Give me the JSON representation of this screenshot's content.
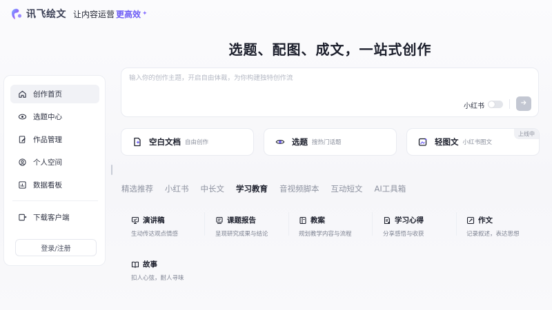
{
  "header": {
    "brand": "讯飞绘文",
    "slogan_prefix": "让内容运营",
    "slogan_highlight": "更高效",
    "logo_icon": "iflytek-logo-icon"
  },
  "sidebar": {
    "items": [
      {
        "label": "创作首页",
        "icon": "home-icon",
        "active": true
      },
      {
        "label": "选题中心",
        "icon": "eye-icon"
      },
      {
        "label": "作品管理",
        "icon": "edit-doc-icon"
      },
      {
        "label": "个人空间",
        "icon": "user-space-icon"
      },
      {
        "label": "数据看板",
        "icon": "chart-icon"
      },
      {
        "label": "下载客户端",
        "icon": "download-client-icon"
      }
    ],
    "login_label": "登录/注册"
  },
  "main": {
    "title": "选题、配图、成文，一站式创作",
    "prompt_placeholder": "输入你的创作主题，开启自由体裁，为你构建独特创作流",
    "xhs_toggle_label": "小红书",
    "xhs_toggle_on": false
  },
  "modes": [
    {
      "title": "空白文档",
      "subtitle": "自由创作",
      "icon": "blank-doc-icon"
    },
    {
      "title": "选题",
      "subtitle": "搜热门话题",
      "icon": "topic-eye-icon"
    },
    {
      "title": "轻图文",
      "subtitle": "小红书图文",
      "icon": "image-text-icon",
      "badge": "上线中"
    }
  ],
  "tabs": [
    "精选推荐",
    "小红书",
    "中长文",
    "学习教育",
    "音视频脚本",
    "互动短文",
    "AI工具箱"
  ],
  "active_tab": "学习教育",
  "templates": [
    {
      "title": "演讲稿",
      "desc": "生动传达观点情感"
    },
    {
      "title": "课题报告",
      "desc": "呈现研究成果与结论"
    },
    {
      "title": "教案",
      "desc": "规划教学内容与流程"
    },
    {
      "title": "学习心得",
      "desc": "分享感悟与收获"
    },
    {
      "title": "作文",
      "desc": "记录叙述，表达思想"
    },
    {
      "title": "故事",
      "desc": "扣人心弦，耐人寻味"
    }
  ],
  "colors": {
    "accent": "#6c5cf5",
    "active_bg": "#f1f2f6"
  }
}
